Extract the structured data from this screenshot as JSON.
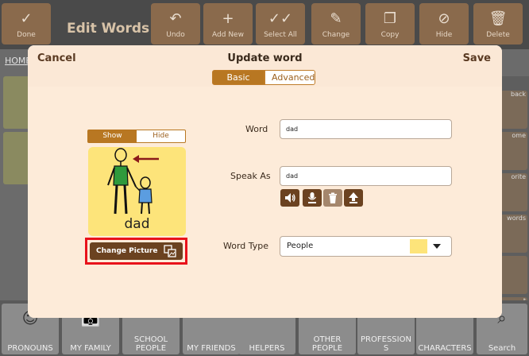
{
  "background": {
    "title": "Edit Words",
    "breadcrumb": "HOME",
    "toolbar": [
      {
        "label": "Done",
        "icon": "check-icon"
      },
      {
        "label": "Undo",
        "icon": "undo-icon"
      },
      {
        "label": "Add New",
        "icon": "plus-icon"
      },
      {
        "label": "Select All",
        "icon": "double-check-icon"
      },
      {
        "label": "Change",
        "icon": "pencil-icon"
      },
      {
        "label": "Copy",
        "icon": "copy-icon"
      },
      {
        "label": "Hide",
        "icon": "hide-icon"
      },
      {
        "label": "Delete",
        "icon": "trash-icon"
      }
    ],
    "right_column": [
      "back",
      "ome",
      "orite",
      "words",
      "",
      "t"
    ],
    "bottom_tiles": [
      "PRONOUNS",
      "MY FAMILY",
      "SCHOOL PEOPLE",
      "MY FRIENDS",
      "HELPERS",
      "OTHER PEOPLE",
      "PROFESSION S",
      "CHARACTERS",
      "Search"
    ]
  },
  "modal": {
    "cancel_label": "Cancel",
    "title": "Update word",
    "save_label": "Save",
    "tabs": [
      {
        "label": "Basic",
        "active": true
      },
      {
        "label": "Advanced",
        "active": false
      }
    ],
    "image_toggle": {
      "show_label": "Show",
      "hide_label": "Hide",
      "selected": "Show"
    },
    "picture_label": "dad",
    "change_picture_label": "Change Picture",
    "word": {
      "label": "Word",
      "value": "dad"
    },
    "speak_as": {
      "label": "Speak As",
      "value": "dad",
      "buttons": [
        "speaker-icon",
        "microphone-icon",
        "trash-icon",
        "upload-icon"
      ]
    },
    "word_type": {
      "label": "Word Type",
      "value": "People",
      "swatch_color": "#fde47a"
    }
  }
}
